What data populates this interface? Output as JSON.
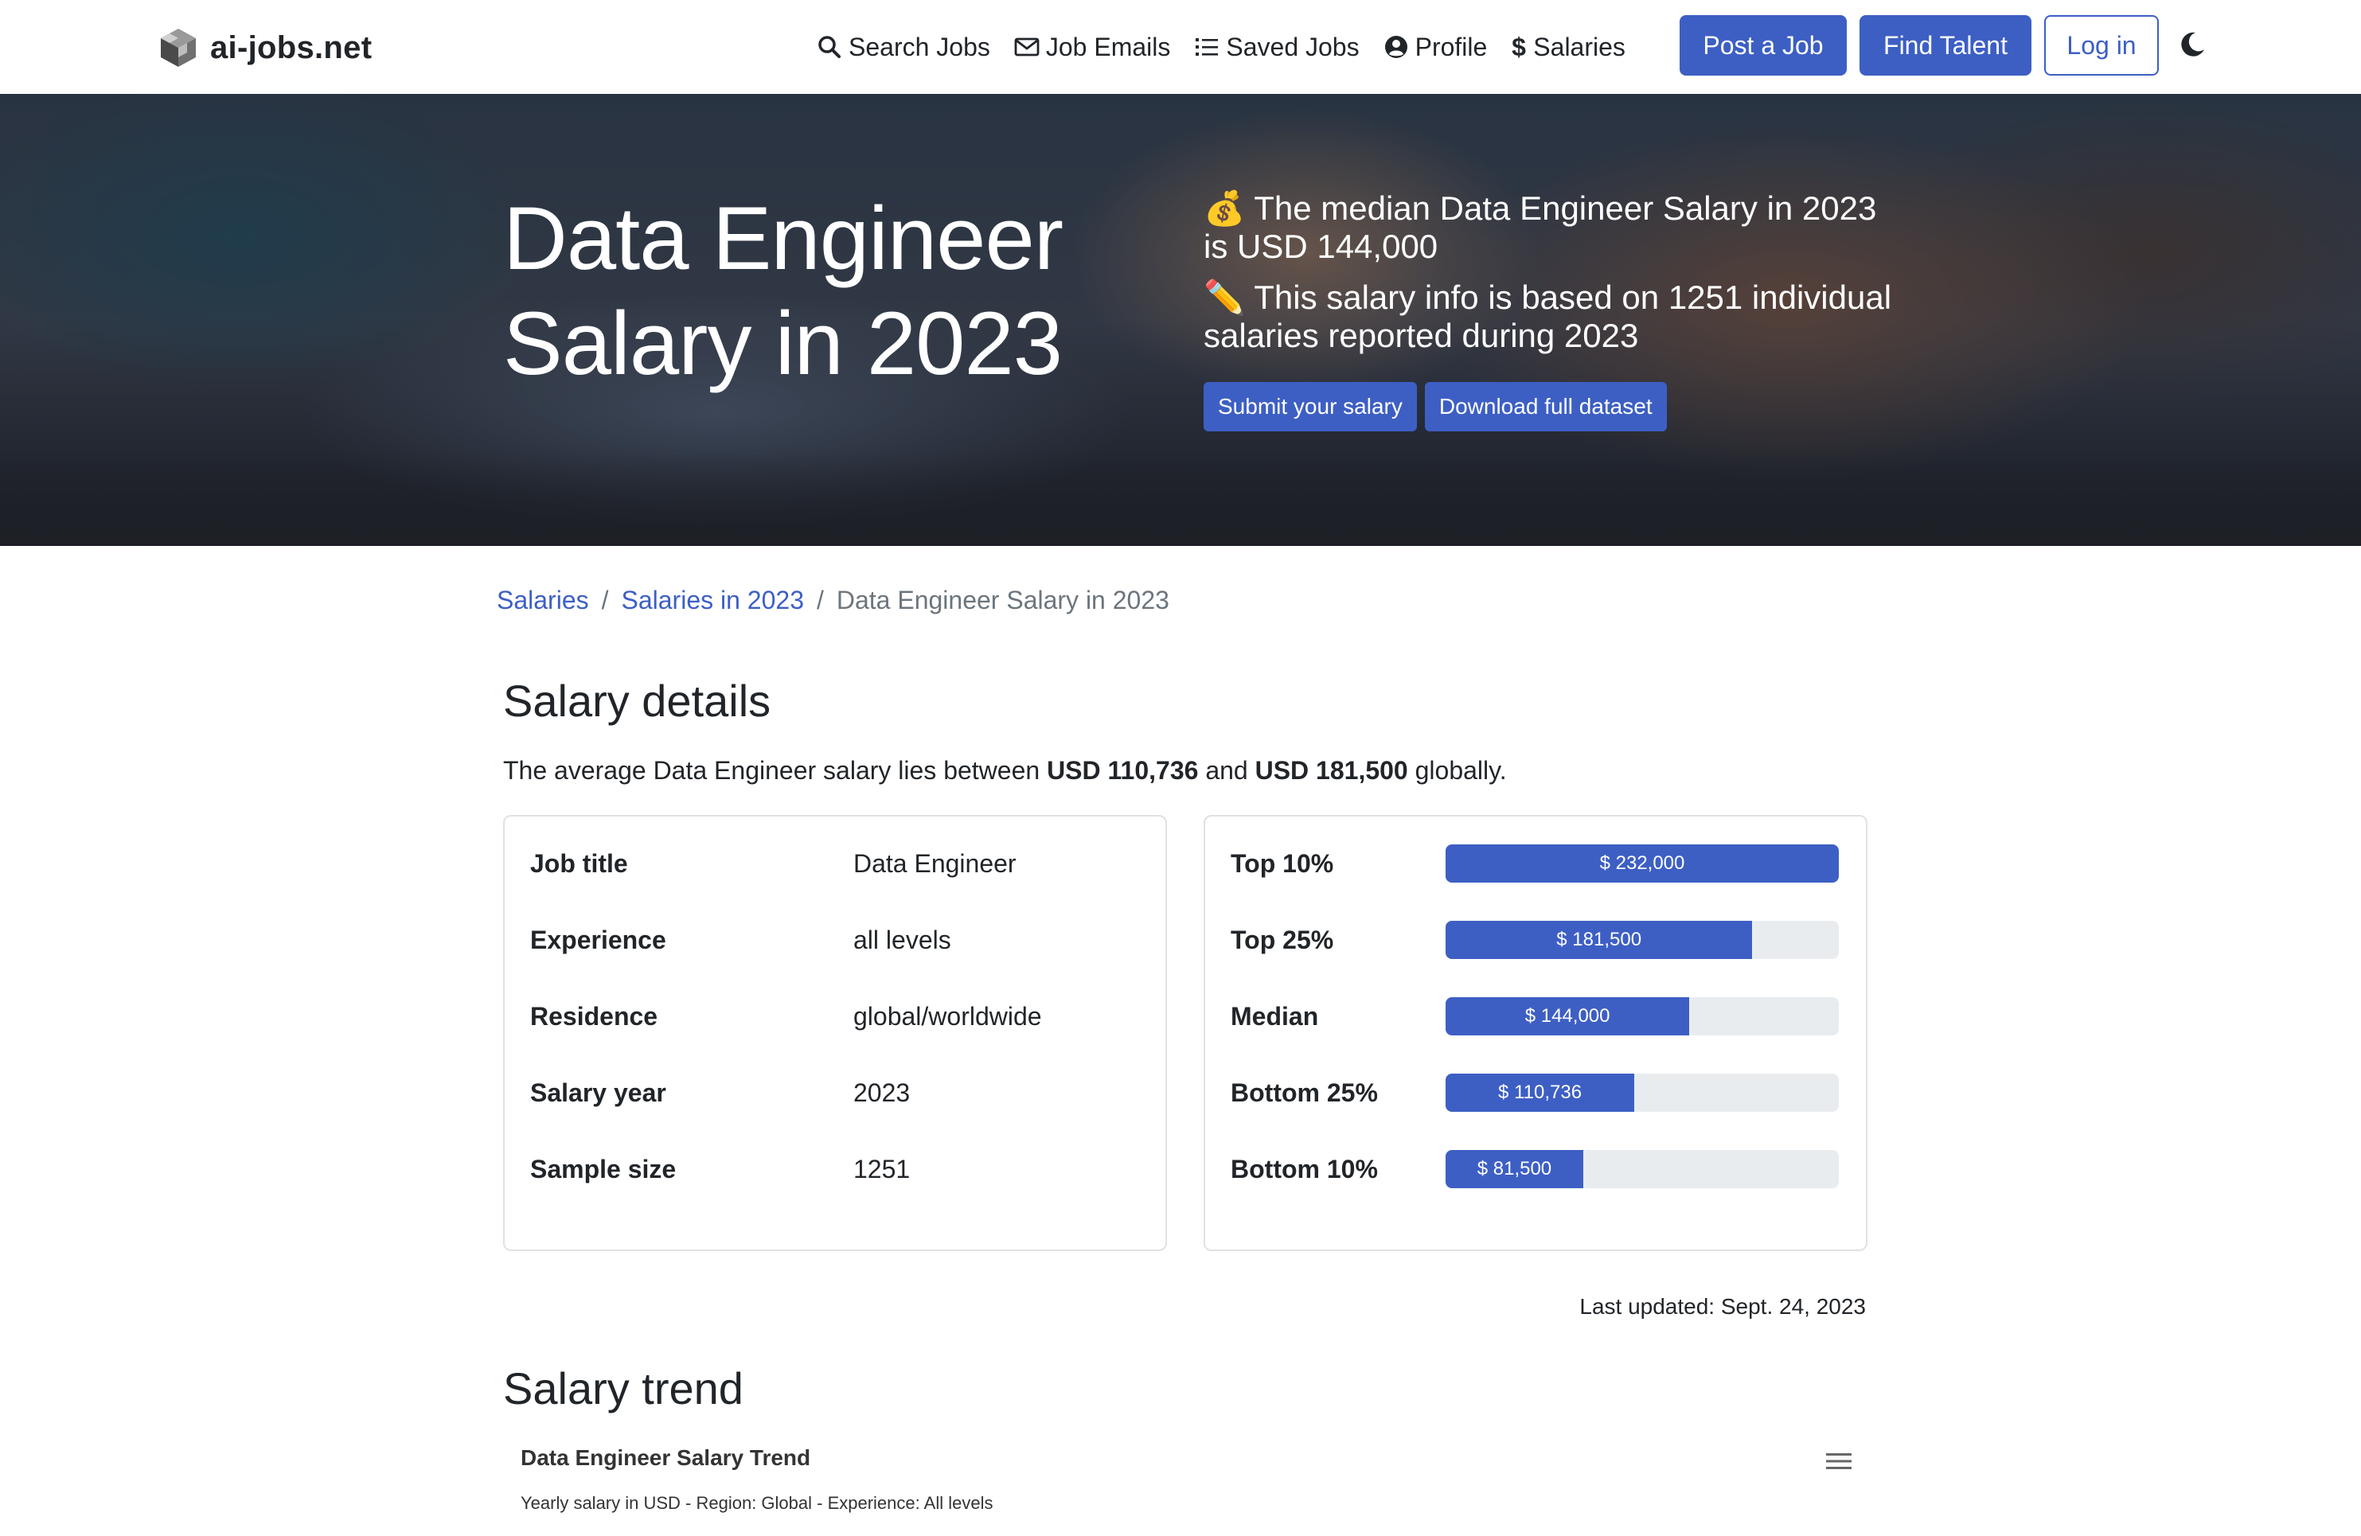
{
  "brand": {
    "name": "ai-jobs.net",
    "logo_icon": "cube-logo-icon"
  },
  "nav": {
    "links": [
      {
        "label": "Search Jobs",
        "icon": "search-icon"
      },
      {
        "label": "Job Emails",
        "icon": "envelope-icon"
      },
      {
        "label": "Saved Jobs",
        "icon": "list-icon"
      },
      {
        "label": "Profile",
        "icon": "user-circle-icon"
      },
      {
        "label": "Salaries",
        "icon": "dollar-icon"
      }
    ],
    "post_job": "Post a Job",
    "find_talent": "Find Talent",
    "login": "Log in",
    "theme_icon": "moon-icon"
  },
  "hero": {
    "title": "Data Engineer Salary in 2023",
    "median_emoji": "💰",
    "median_text": "The median Data Engineer Salary in 2023 is USD 144,000",
    "basis_emoji": "✏️",
    "basis_pre": "This salary info is based on ",
    "basis_bold": "1251 individual",
    "basis_post": " salaries reported during 2023",
    "submit_btn": "Submit your salary",
    "download_btn": "Download full dataset"
  },
  "breadcrumb": {
    "items": [
      "Salaries",
      "Salaries in 2023"
    ],
    "current": "Data Engineer Salary in 2023",
    "separator": "/"
  },
  "details": {
    "heading": "Salary details",
    "summary_pre": "The average Data Engineer salary lies between ",
    "summary_low": "USD 110,736",
    "summary_mid": " and ",
    "summary_high": "USD 181,500",
    "summary_post": " globally.",
    "table": [
      {
        "label": "Job title",
        "value": "Data Engineer"
      },
      {
        "label": "Experience",
        "value": "all levels"
      },
      {
        "label": "Residence",
        "value": "global/worldwide"
      },
      {
        "label": "Salary year",
        "value": "2023"
      },
      {
        "label": "Sample size",
        "value": "1251"
      }
    ],
    "percentiles": [
      {
        "label": "Top 10%",
        "value": "$ 232,000",
        "fraction": 1.0
      },
      {
        "label": "Top 25%",
        "value": "$ 181,500",
        "fraction": 0.78
      },
      {
        "label": "Median",
        "value": "$ 144,000",
        "fraction": 0.62
      },
      {
        "label": "Bottom 25%",
        "value": "$ 110,736",
        "fraction": 0.48
      },
      {
        "label": "Bottom 10%",
        "value": "$ 81,500",
        "fraction": 0.35
      }
    ],
    "updated": "Last updated: Sept. 24, 2023"
  },
  "trend": {
    "heading": "Salary trend",
    "chart_title": "Data Engineer Salary Trend",
    "chart_subtitle": "Yearly salary in USD - Region: Global - Experience: All levels",
    "menu_icon": "hamburger-menu-icon"
  },
  "colors": {
    "accent": "#3d5fc4",
    "track": "#e9ecef",
    "border": "#dee2e6"
  }
}
